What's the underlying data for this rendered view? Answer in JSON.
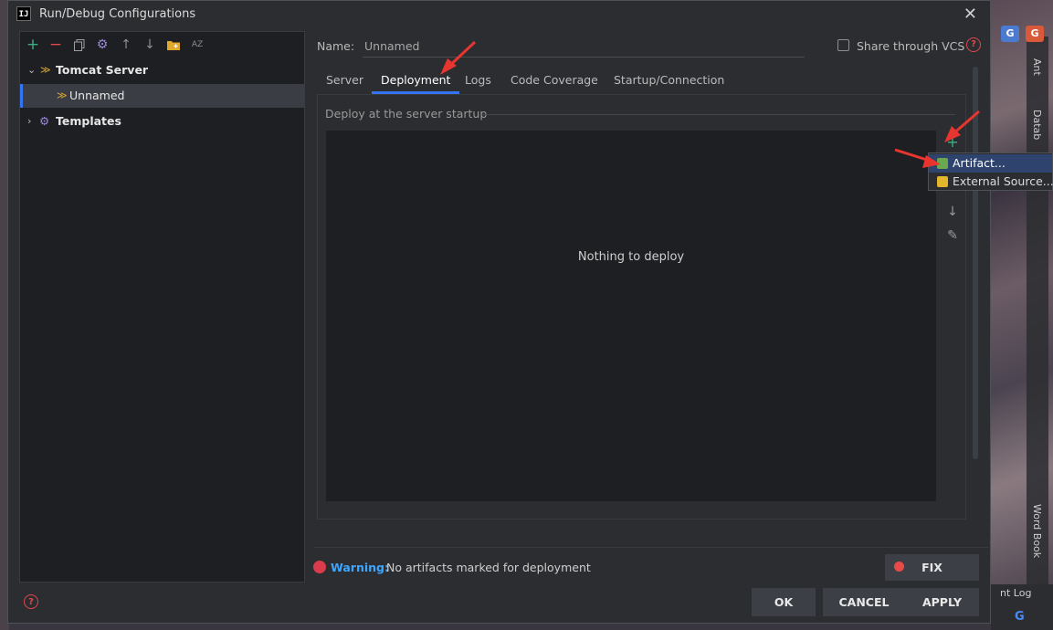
{
  "window": {
    "title": "Run/Debug Configurations",
    "app_icon_text": "IJ"
  },
  "toolbar": {
    "add": "+",
    "remove": "−",
    "copy": "⧉",
    "settings": "⚙",
    "up": "↑",
    "down": "↓",
    "folder": "▪",
    "sort": "AZ"
  },
  "tree": {
    "group": "Tomcat Server",
    "child": "Unnamed",
    "templates": "Templates"
  },
  "config": {
    "name_label": "Name:",
    "name_value": "Unnamed",
    "share_label": "Share through VCS"
  },
  "tabs": [
    "Server",
    "Deployment",
    "Logs",
    "Code Coverage",
    "Startup/Connection"
  ],
  "deployment": {
    "section_title": "Deploy at the server startup",
    "empty_text": "Nothing to deploy"
  },
  "popup": {
    "items": [
      "Artifact...",
      "External Source..."
    ]
  },
  "warning": {
    "label": "Warning:",
    "text": "No artifacts marked for deployment"
  },
  "buttons": {
    "fix": "FIX",
    "ok": "OK",
    "cancel": "CANCEL",
    "apply": "APPLY"
  },
  "side_panel": {
    "ant": "Ant",
    "database": "Datab",
    "word_book": "Word Book",
    "event_log": "nt Log"
  },
  "colors": {
    "accent": "#3574f0",
    "selection": "#2e436e",
    "warning_label": "#3ea6ff",
    "annotation_arrow": "#e8352f"
  }
}
